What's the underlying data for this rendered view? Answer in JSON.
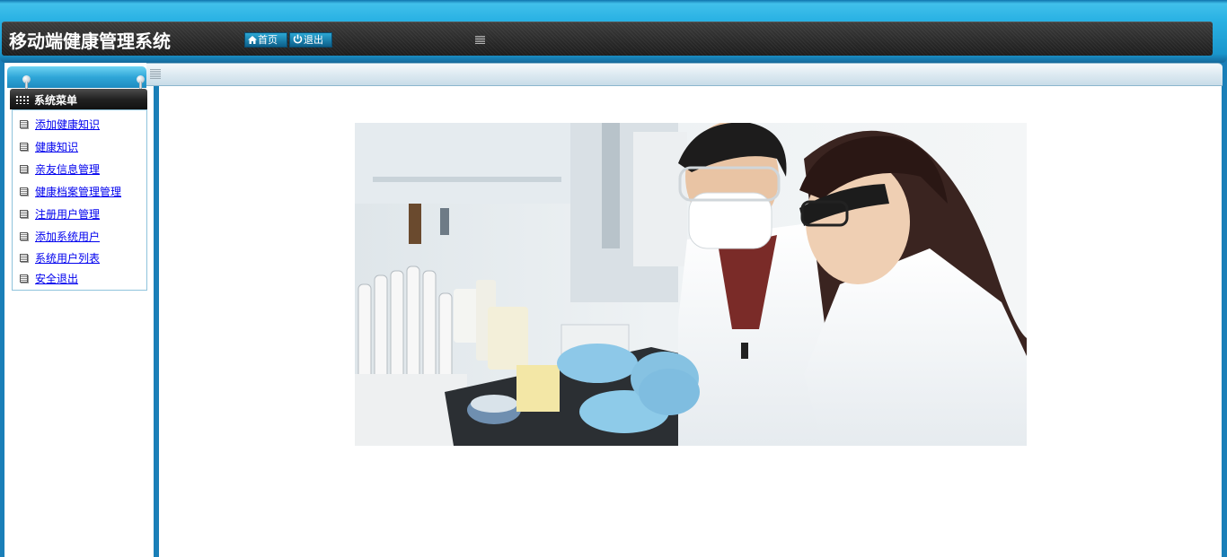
{
  "header": {
    "title": "移动端健康管理系统",
    "home_label": "首页",
    "logout_label": "退出"
  },
  "sidebar": {
    "header_label": "系统菜单",
    "items": [
      {
        "label": "添加健康知识"
      },
      {
        "label": "健康知识"
      },
      {
        "label": "亲友信息管理"
      },
      {
        "label": "健康档案管理管理"
      },
      {
        "label": "注册用户管理"
      },
      {
        "label": "添加系统用户"
      },
      {
        "label": "系统用户列表"
      },
      {
        "label": "安全退出"
      }
    ]
  },
  "icons": {
    "home": "home-icon",
    "power": "power-icon",
    "menu_grid": "grid-icon",
    "menu_item": "document-icon"
  },
  "colors": {
    "frame_blue": "#1a7fb8",
    "top_bar_dark": "#2a2a2a",
    "link_blue": "#0000ee",
    "button_blue": "#1c86b6"
  },
  "main": {
    "image_alt": "实验室研究人员"
  }
}
